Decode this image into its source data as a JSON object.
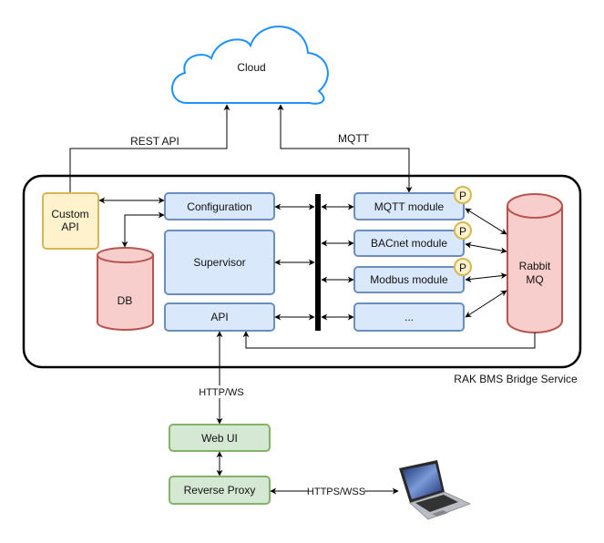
{
  "nodes": {
    "cloud": "Cloud",
    "custom_api": [
      "Custom",
      "API"
    ],
    "configuration": "Configuration",
    "supervisor": "Supervisor",
    "api": "API",
    "db": "DB",
    "mqtt_module": "MQTT module",
    "bacnet_module": "BACnet module",
    "modbus_module": "Modbus module",
    "more_modules": "...",
    "rabbitmq": [
      "Rabbit",
      "MQ"
    ],
    "plugin_badge": "P",
    "web_ui": "Web UI",
    "reverse_proxy": "Reverse Proxy"
  },
  "edges": {
    "rest_api": "REST API",
    "mqtt": "MQTT",
    "http_ws": "HTTP/WS",
    "https_wss": "HTTPS/WSS"
  },
  "container_label": "RAK BMS Bridge Service",
  "colors": {
    "service_fill": "#dae8fc",
    "external_fill": "#fff2cc",
    "storage_fill": "#f8cecc",
    "frontend_fill": "#d5e8d4",
    "cloud_stroke": "#1e90ff"
  }
}
